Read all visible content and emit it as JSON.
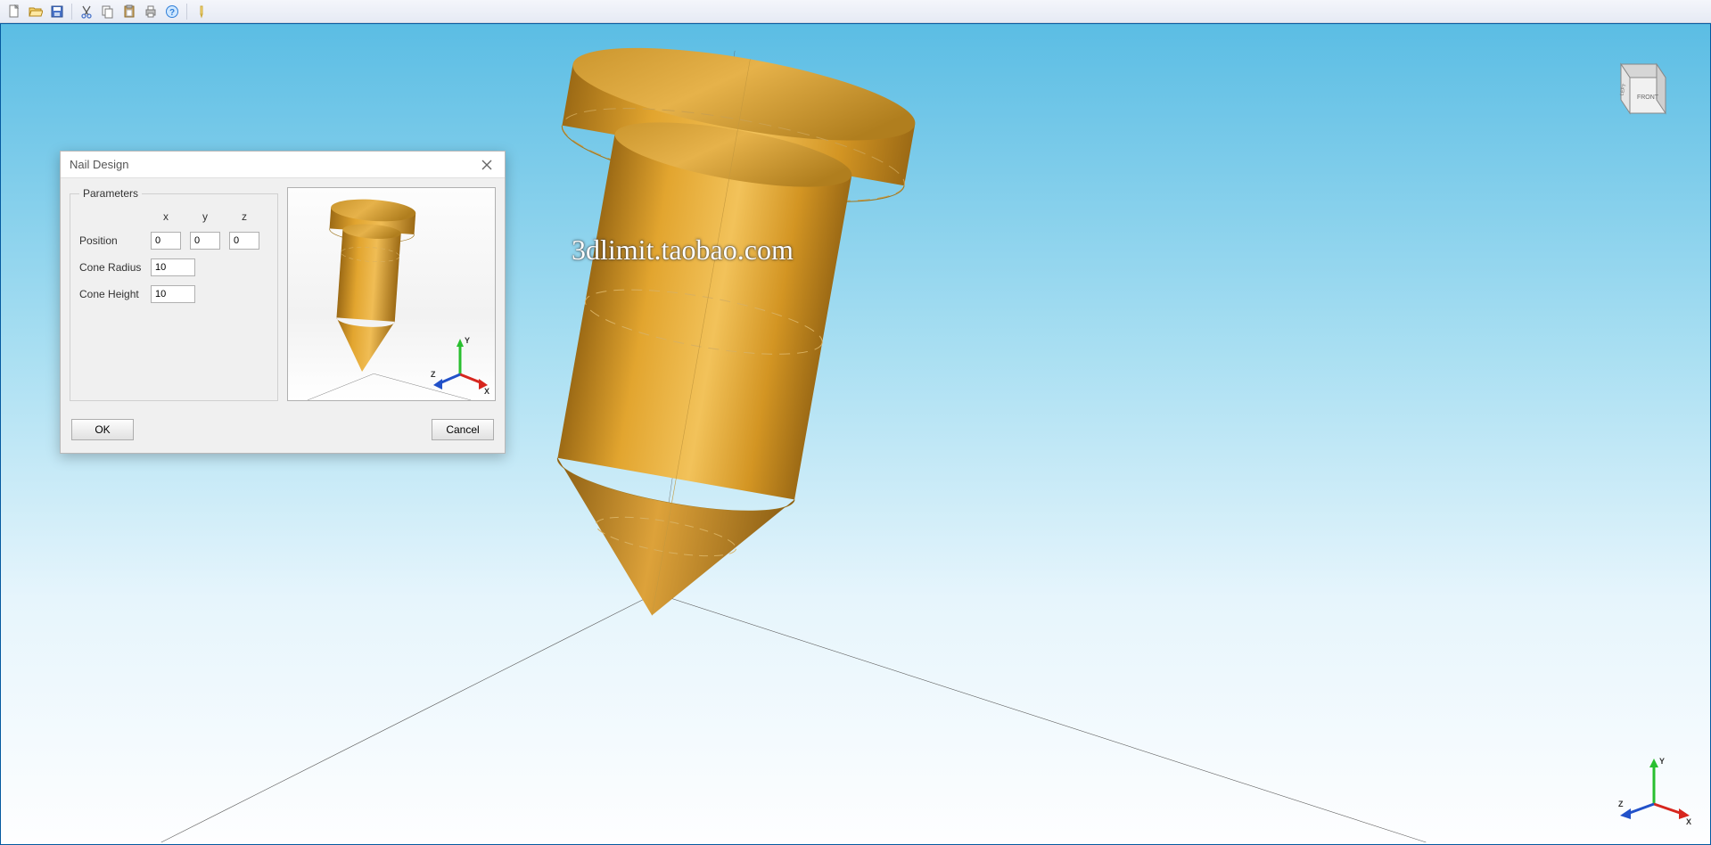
{
  "toolbar": {
    "icons": [
      "new-file",
      "open-file",
      "save-file",
      "cut",
      "copy",
      "paste",
      "print",
      "help",
      "marker"
    ]
  },
  "watermark": "3dlimit.taobao.com",
  "viewcube": {
    "front_label": "FRONT",
    "left_label": "LEFT"
  },
  "axis": {
    "x_label": "X",
    "y_label": "Y",
    "z_label": "Z"
  },
  "dialog": {
    "title": "Nail Design",
    "legend": "Parameters",
    "axis_x": "x",
    "axis_y": "y",
    "axis_z": "z",
    "position_label": "Position",
    "position": {
      "x": "0",
      "y": "0",
      "z": "0"
    },
    "cone_radius_label": "Cone Radius",
    "cone_radius": "10",
    "cone_height_label": "Cone Height",
    "cone_height": "10",
    "ok_label": "OK",
    "cancel_label": "Cancel"
  }
}
